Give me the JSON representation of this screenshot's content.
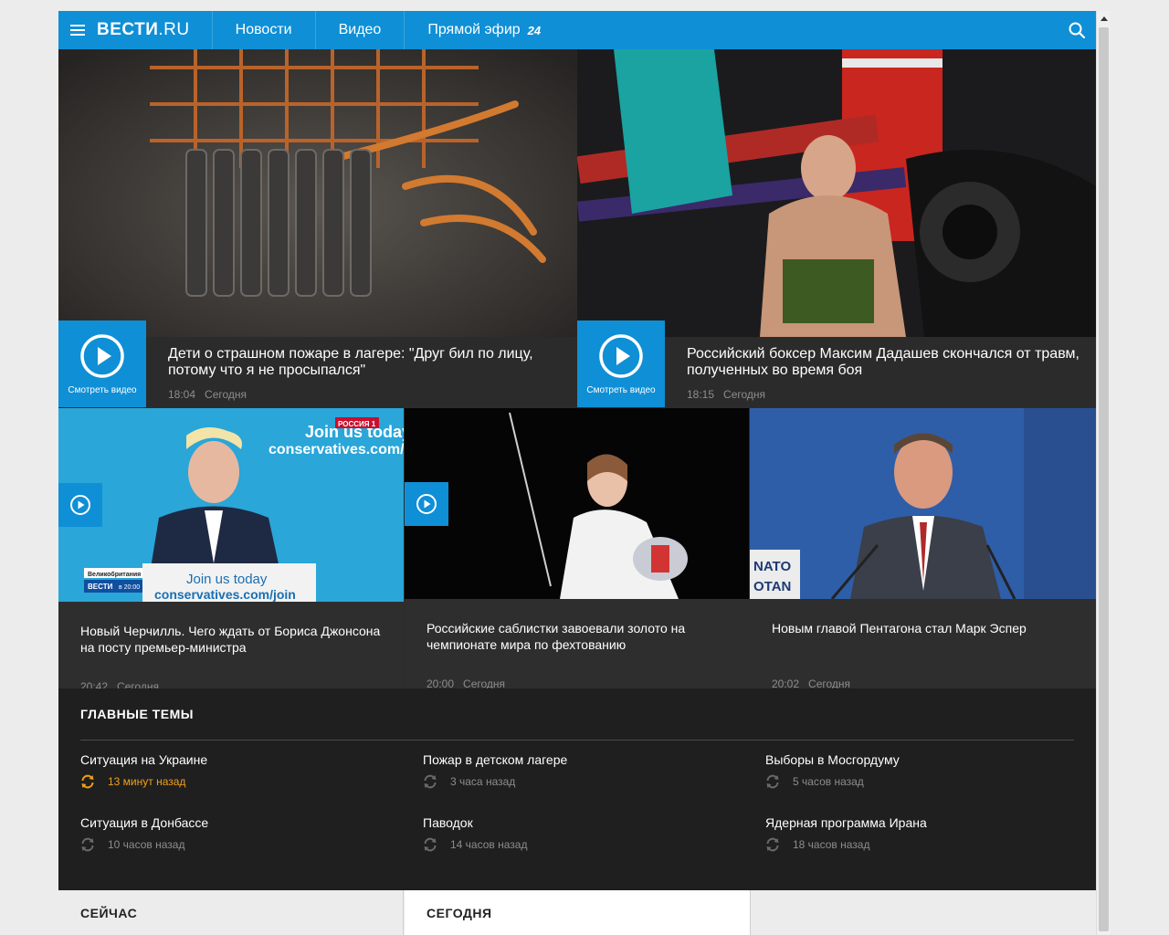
{
  "header": {
    "logo_main": "ВЕСТИ",
    "logo_suffix": ".RU",
    "nav": [
      {
        "label": "Новости"
      },
      {
        "label": "Видео"
      },
      {
        "label": "Прямой эфир",
        "badge": "24"
      }
    ],
    "menu_icon": "hamburger-icon",
    "search_icon": "search-icon",
    "accent_color": "#0f8fd6"
  },
  "top_stories": [
    {
      "title": "Дети о страшном пожаре в лагере: \"Друг бил по лицу, потому что я не просыпался\"",
      "time": "18:04",
      "day": "Сегодня",
      "play_label": "Смотреть видео"
    },
    {
      "title": "Российский боксер Максим Дадашев скончался от травм, полученных во время боя",
      "time": "18:15",
      "day": "Сегодня",
      "play_label": "Смотреть видео"
    }
  ],
  "mid_stories": [
    {
      "title": "Новый Черчилль. Чего ждать от Бориса Джонсона на посту премьер-министра",
      "time": "20:42",
      "day": "Сегодня",
      "has_video": true,
      "image_text": {
        "banner": "Join us today",
        "site": "conservatives.com/",
        "podium_line1": "Join us today",
        "podium_line2": "conservatives.com/join",
        "channel": "РОССИЯ 1",
        "tag_country": "Великобритания",
        "tag_show": "ВЕСТИ",
        "tag_time": "в 20:00"
      }
    },
    {
      "title": "Российские саблистки завоевали золото на чемпионате мира по фехтованию",
      "time": "20:00",
      "day": "Сегодня",
      "has_video": true
    },
    {
      "title": "Новым главой Пентагона стал Марк Эспер",
      "time": "20:02",
      "day": "Сегодня",
      "has_video": false,
      "image_text": {
        "sign_line1": "NATO",
        "sign_line2": "OTAN"
      }
    }
  ],
  "topics": {
    "heading": "ГЛАВНЫЕ ТЕМЫ",
    "items": [
      {
        "name": "Ситуация на Украине",
        "updated": "13 минут назад",
        "hot": true
      },
      {
        "name": "Пожар в детском лагере",
        "updated": "3 часа назад",
        "hot": false
      },
      {
        "name": "Выборы в Мосгордуму",
        "updated": "5 часов назад",
        "hot": false
      },
      {
        "name": "Ситуация в Донбассе",
        "updated": "10 часов назад",
        "hot": false
      },
      {
        "name": "Паводок",
        "updated": "14 часов назад",
        "hot": false
      },
      {
        "name": "Ядерная программа Ирана",
        "updated": "18 часов назад",
        "hot": false
      }
    ],
    "hot_color": "#f0a018"
  },
  "bottom_tabs": [
    {
      "label": "СЕЙЧАС"
    },
    {
      "label": "СЕГОДНЯ"
    },
    {
      "label": ""
    }
  ]
}
